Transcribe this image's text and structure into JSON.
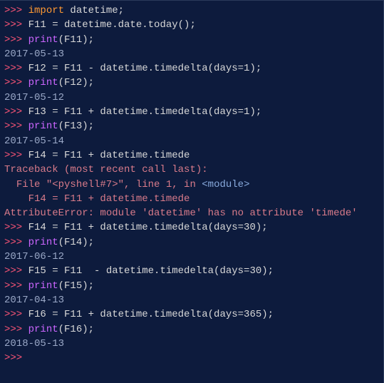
{
  "lines": [
    {
      "type": "input",
      "parts": [
        {
          "cls": "prompt",
          "t": ">>> "
        },
        {
          "cls": "kw",
          "t": "import"
        },
        {
          "cls": "txt",
          "t": " datetime;"
        }
      ]
    },
    {
      "type": "input",
      "parts": [
        {
          "cls": "prompt",
          "t": ">>> "
        },
        {
          "cls": "txt",
          "t": "F11 = datetime.date.today();"
        }
      ]
    },
    {
      "type": "input",
      "parts": [
        {
          "cls": "prompt",
          "t": ">>> "
        },
        {
          "cls": "fn",
          "t": "print"
        },
        {
          "cls": "txt",
          "t": "(F11);"
        }
      ]
    },
    {
      "type": "output",
      "parts": [
        {
          "cls": "out",
          "t": "2017-05-13"
        }
      ]
    },
    {
      "type": "input",
      "parts": [
        {
          "cls": "prompt",
          "t": ">>> "
        },
        {
          "cls": "txt",
          "t": "F12 = F11 - datetime.timedelta(days=1);"
        }
      ]
    },
    {
      "type": "input",
      "parts": [
        {
          "cls": "prompt",
          "t": ">>> "
        },
        {
          "cls": "fn",
          "t": "print"
        },
        {
          "cls": "txt",
          "t": "(F12);"
        }
      ]
    },
    {
      "type": "output",
      "parts": [
        {
          "cls": "out",
          "t": "2017-05-12"
        }
      ]
    },
    {
      "type": "input",
      "parts": [
        {
          "cls": "prompt",
          "t": ">>> "
        },
        {
          "cls": "txt",
          "t": "F13 = F11 + datetime.timedelta(days=1);"
        }
      ]
    },
    {
      "type": "input",
      "parts": [
        {
          "cls": "prompt",
          "t": ">>> "
        },
        {
          "cls": "fn",
          "t": "print"
        },
        {
          "cls": "txt",
          "t": "(F13);"
        }
      ]
    },
    {
      "type": "output",
      "parts": [
        {
          "cls": "out",
          "t": "2017-05-14"
        }
      ]
    },
    {
      "type": "input",
      "parts": [
        {
          "cls": "prompt",
          "t": ">>> "
        },
        {
          "cls": "txt",
          "t": "F14 = F11 + datetime.timede"
        }
      ]
    },
    {
      "type": "error",
      "parts": [
        {
          "cls": "err",
          "t": "Traceback (most recent call last):"
        }
      ]
    },
    {
      "type": "error",
      "parts": [
        {
          "cls": "err",
          "t": "  File \"<pyshell#7>\", line 1, in "
        },
        {
          "cls": "tag",
          "t": "<module>"
        }
      ]
    },
    {
      "type": "error",
      "parts": [
        {
          "cls": "err",
          "t": "    F14 = F11 + datetime.timede"
        }
      ]
    },
    {
      "type": "error",
      "parts": [
        {
          "cls": "err",
          "t": "AttributeError: module 'datetime' has no attribute 'timede'"
        }
      ]
    },
    {
      "type": "input",
      "parts": [
        {
          "cls": "prompt",
          "t": ">>> "
        },
        {
          "cls": "txt",
          "t": "F14 = F11 + datetime.timedelta(days=30);"
        }
      ]
    },
    {
      "type": "input",
      "parts": [
        {
          "cls": "prompt",
          "t": ">>> "
        },
        {
          "cls": "fn",
          "t": "print"
        },
        {
          "cls": "txt",
          "t": "(F14);"
        }
      ]
    },
    {
      "type": "output",
      "parts": [
        {
          "cls": "out",
          "t": "2017-06-12"
        }
      ]
    },
    {
      "type": "input",
      "parts": [
        {
          "cls": "prompt",
          "t": ">>> "
        },
        {
          "cls": "txt",
          "t": "F15 = F11  - datetime.timedelta(days=30);"
        }
      ]
    },
    {
      "type": "input",
      "parts": [
        {
          "cls": "prompt",
          "t": ">>> "
        },
        {
          "cls": "fn",
          "t": "print"
        },
        {
          "cls": "txt",
          "t": "(F15);"
        }
      ]
    },
    {
      "type": "output",
      "parts": [
        {
          "cls": "out",
          "t": "2017-04-13"
        }
      ]
    },
    {
      "type": "input",
      "parts": [
        {
          "cls": "prompt",
          "t": ">>> "
        },
        {
          "cls": "txt",
          "t": "F16 = F11 + datetime.timedelta(days=365);"
        }
      ]
    },
    {
      "type": "input",
      "parts": [
        {
          "cls": "prompt",
          "t": ">>> "
        },
        {
          "cls": "fn",
          "t": "print"
        },
        {
          "cls": "txt",
          "t": "(F16);"
        }
      ]
    },
    {
      "type": "output",
      "parts": [
        {
          "cls": "out",
          "t": "2018-05-13"
        }
      ]
    },
    {
      "type": "input",
      "parts": [
        {
          "cls": "prompt",
          "t": ">>> "
        }
      ]
    }
  ]
}
